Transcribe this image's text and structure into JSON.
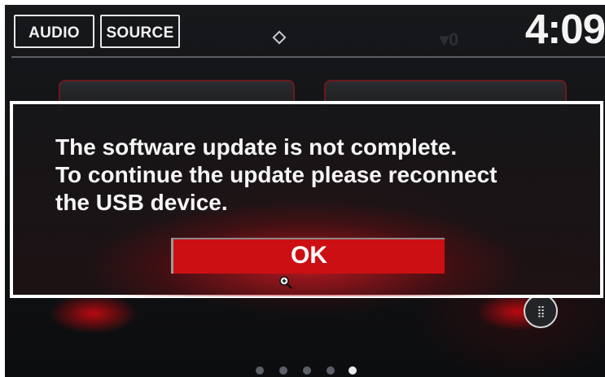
{
  "header": {
    "audio_label": "AUDIO",
    "source_label": "SOURCE",
    "clock": "4:09",
    "signal_text": "▾0"
  },
  "dialog": {
    "lines": [
      "The software update is not complete.",
      "To continue the update please reconnect",
      "the USB device."
    ],
    "ok_label": "OK"
  },
  "home": {
    "apps_icon_glyph": "⣿",
    "page_count": 5,
    "active_page": 5
  },
  "colors": {
    "accent_red": "#cc0f12",
    "text_white": "#f6f6f6",
    "dialog_border": "#ffffff"
  },
  "icons": {
    "status": "diamond-icon",
    "signal": "signal-icon",
    "apps": "apps-grid-icon",
    "cursor": "zoom-cursor-icon"
  }
}
